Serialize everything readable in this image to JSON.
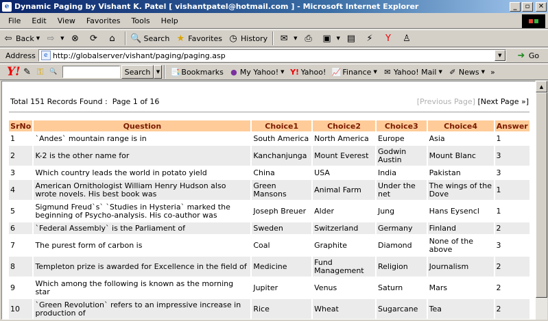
{
  "window": {
    "title": "Dynamic Paging by Vishant K. Patel [ vishantpatel@hotmail.com ] - Microsoft Internet Explorer"
  },
  "menu": [
    "File",
    "Edit",
    "View",
    "Favorites",
    "Tools",
    "Help"
  ],
  "toolbar": {
    "back": "Back",
    "search": "Search",
    "favorites": "Favorites",
    "history": "History"
  },
  "address": {
    "label": "Address",
    "url": "http://globalserver/vishant/paging/paging.asp",
    "go": "Go"
  },
  "yahoo_bar": {
    "search_button": "Search",
    "items": [
      "Bookmarks",
      "My Yahoo!",
      "Yahoo!",
      "Finance",
      "Yahoo! Mail",
      "News"
    ],
    "more": "»"
  },
  "page": {
    "summary": "Total 151 Records Found :  Page 1 of 16",
    "pager": {
      "prev": "[Previous Page]",
      "next": "[Next Page »]"
    },
    "columns": [
      "SrNo",
      "Question",
      "Choice1",
      "Choice2",
      "Choice3",
      "Choice4",
      "Answer"
    ],
    "rows": [
      [
        "1",
        "`Andes` mountain range is in",
        "South America",
        "North America",
        "Europe",
        "Asia",
        "1"
      ],
      [
        "2",
        "K-2 is the other name for",
        "Kanchanjunga",
        "Mount Everest",
        "Godwin Austin",
        "Mount Blanc",
        "3"
      ],
      [
        "3",
        "Which country leads the world in potato yield",
        "China",
        "USA",
        "India",
        "Pakistan",
        "3"
      ],
      [
        "4",
        "American Ornithologist William Henry Hudson also wrote novels. His best book was",
        "Green Mansons",
        "Animal Farm",
        "Under the net",
        "The wings of the Dove",
        "1"
      ],
      [
        "5",
        "Sigmund Freud`s` `Studies in Hysteria` marked the beginning of Psycho-analysis. His co-author was",
        "Joseph Breuer",
        "Alder",
        "Jung",
        "Hans Eysencl",
        "1"
      ],
      [
        "6",
        "`Federal Assembly` is the Parliament of",
        "Sweden",
        "Switzerland",
        "Germany",
        "Finland",
        "2"
      ],
      [
        "7",
        "The purest form of carbon is",
        "Coal",
        "Graphite",
        "Diamond",
        "None of the above",
        "3"
      ],
      [
        "8",
        "Templeton prize is awarded for Excellence in the field of",
        "Medicine",
        "Fund Management",
        "Religion",
        "Journalism",
        "2"
      ],
      [
        "9",
        "Which among the following is known as the morning star",
        "Jupiter",
        "Venus",
        "Saturn",
        "Mars",
        "2"
      ],
      [
        "10",
        "`Green Revolution` refers to an impressive increase in production of",
        "Rice",
        "Wheat",
        "Sugarcane",
        "Tea",
        "2"
      ]
    ]
  }
}
